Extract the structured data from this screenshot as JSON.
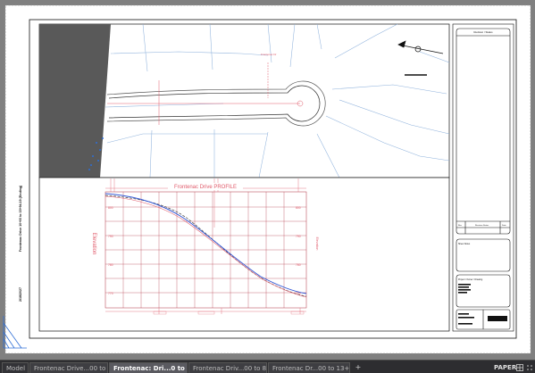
{
  "tabs": {
    "model": "Model",
    "layouts": [
      "Frontenac Drive...00 to 4+78.00",
      "Frontenac: Dri...0 to 15+94.19",
      "Frontenac Driv...00 to 8+56.00",
      "Frontenac Dr...00 to 13+25.00"
    ],
    "active_index": 1,
    "add": "+"
  },
  "status": {
    "space": "PAPER"
  },
  "sheet": {
    "profile_title": "Frontenac Drive PROFILE",
    "profile_ylabel_left": "Elevation",
    "profile_ylabel_right": "Elevation",
    "elev_labels_left": [
      "800",
      "790",
      "780",
      "770"
    ],
    "elev_labels_right": [
      "800",
      "790",
      "780",
      "770"
    ],
    "vertical_title": "Frontenac Drive 10+00 to 15+94.19 (Ending)",
    "date": "2/18/2027",
    "title_block_header": "Revision / Status",
    "rev_headers": [
      "Rev",
      "Revision Status",
      "Date"
    ],
    "box_notes": "Sheet Notes",
    "box_info": "Project / Owner / Drawing"
  },
  "colors": {
    "paper": "#ffffff",
    "canvas": "#808080",
    "plan_lines": "#7fa8d4",
    "profile_red": "#e05a6a",
    "grid": "#b03040",
    "border": "#101010"
  }
}
